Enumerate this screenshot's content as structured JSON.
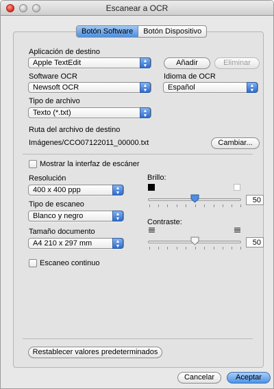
{
  "window": {
    "title": "Escanear a OCR"
  },
  "tabs": [
    {
      "label": "Botón Software",
      "active": true
    },
    {
      "label": "Botón Dispositivo",
      "active": false
    }
  ],
  "destination_app": {
    "label": "Aplicación de destino",
    "value": "Apple TextEdit",
    "add_button": "Añadir",
    "remove_button": "Eliminar"
  },
  "ocr_software": {
    "label": "Software OCR",
    "value": "Newsoft OCR"
  },
  "ocr_language": {
    "label": "Idioma de OCR",
    "value": "Español"
  },
  "file_type": {
    "label": "Tipo de archivo",
    "value": "Texto (*.txt)"
  },
  "destination_path": {
    "label": "Ruta del archivo de destino",
    "value": "Imágenes/CCO07122011_00000.txt",
    "change_button": "Cambiar..."
  },
  "scanner_interface": {
    "label": "Mostrar la interfaz de escáner",
    "checked": false
  },
  "resolution": {
    "label": "Resolución",
    "value": "400 x 400 ppp"
  },
  "scan_type": {
    "label": "Tipo de escaneo",
    "value": "Blanco y negro"
  },
  "document_size": {
    "label": "Tamaño documento",
    "value": "A4 210 x 297 mm"
  },
  "continuous_scan": {
    "label": "Escaneo continuo",
    "checked": false
  },
  "brightness": {
    "label": "Brillo:",
    "value": "50",
    "level": 0.5
  },
  "contrast": {
    "label": "Contraste:",
    "value": "50",
    "level": 0.5
  },
  "footer": {
    "reset_button": "Restablecer valores predeterminados",
    "cancel_button": "Cancelar",
    "accept_button": "Aceptar"
  },
  "colors": {
    "accent": "#4f8fe0",
    "close_button": "#d9281b"
  }
}
